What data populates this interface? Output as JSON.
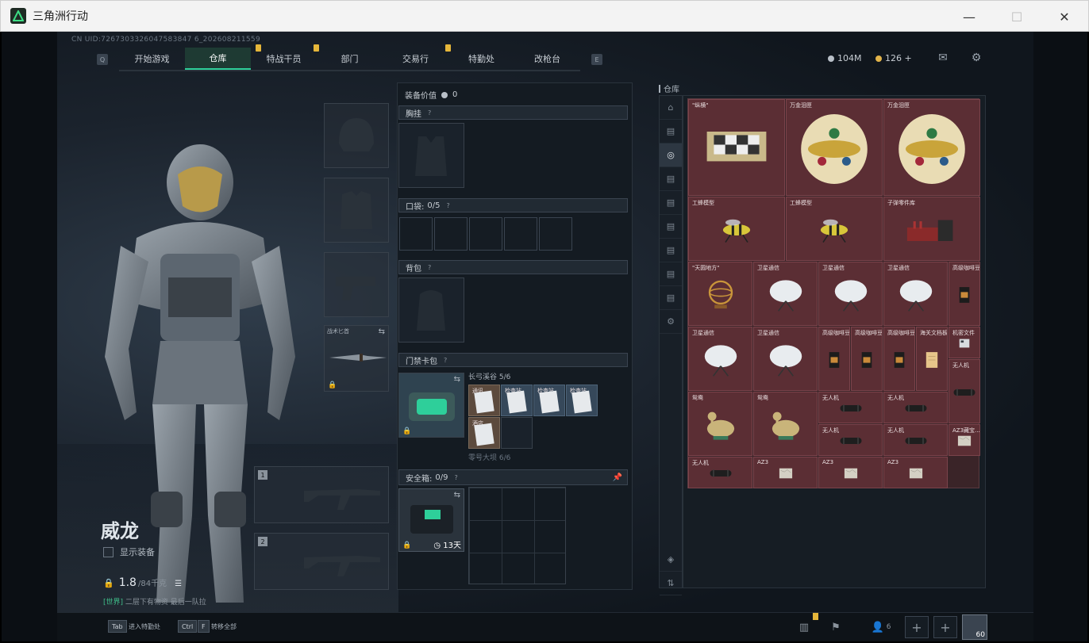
{
  "window": {
    "title": "三角洲行动",
    "minimize": "—",
    "maximize": "☐",
    "close": "✕"
  },
  "uid": "CN UID:7267303326047583847 6_202608211559",
  "nav": {
    "left_key": "Q",
    "right_key": "E",
    "tabs": [
      "开始游戏",
      "仓库",
      "特战干员",
      "部门",
      "交易行",
      "特勤处",
      "改枪台"
    ],
    "active": 1
  },
  "currency": {
    "hafcoin": "104M",
    "coupon": "126 +",
    "hafcoin_color": "#b9c0c8",
    "coupon_color": "#e2b44a"
  },
  "character": {
    "name": "威龙",
    "show_gear_label": "显示装备",
    "weight": "1.8",
    "weight_max": "/84千克",
    "chat_channel": "[世界]",
    "chat_text": " 二层下有物资 最后一队拉"
  },
  "equipment": {
    "knife_label": "战术匕首",
    "weapon_slot_1": "1",
    "weapon_slot_2": "2"
  },
  "gear": {
    "value_label": "装备价值",
    "value": "0",
    "chest_rig": "胸挂",
    "pockets": "口袋:",
    "pockets_value": "0/5",
    "backpack": "背包",
    "keycard": "门禁卡包",
    "card_group_1": "长弓溪谷 5/6",
    "card_group_2": "零号大坝 6/6",
    "mini_items": [
      "通讯",
      "检查站",
      "检查站",
      "检查站",
      "酒店"
    ],
    "safe_label": "安全箱:",
    "safe_value": "0/9",
    "safe_timer": "13天",
    "help": "?"
  },
  "warehouse": {
    "title": "仓库",
    "items": [
      {
        "name": "\"纵横\""
      },
      {
        "name": "万金泪匣"
      },
      {
        "name": "万金泪匣"
      },
      {
        "name": "工蜂模型"
      },
      {
        "name": "工蜂模型"
      },
      {
        "name": "子弹零件库"
      },
      {
        "name": "\"天圆地方\""
      },
      {
        "name": "卫星通信"
      },
      {
        "name": "卫星通信"
      },
      {
        "name": "卫星通信"
      },
      {
        "name": "高级咖啡豆"
      },
      {
        "name": "卫星通信"
      },
      {
        "name": "卫星通信"
      },
      {
        "name": "高级咖啡豆"
      },
      {
        "name": "高级咖啡豆"
      },
      {
        "name": "高级咖啡豆"
      },
      {
        "name": "海关文档板"
      },
      {
        "name": "机密文件"
      },
      {
        "name": "无人机"
      },
      {
        "name": "鸳鸯"
      },
      {
        "name": "鸳鸯"
      },
      {
        "name": "无人机"
      },
      {
        "name": "无人机"
      },
      {
        "name": "无人机"
      },
      {
        "name": "无人机"
      },
      {
        "name": "AZ3藏宝..."
      },
      {
        "name": "无人机"
      },
      {
        "name": "AZ3"
      },
      {
        "name": "AZ3"
      },
      {
        "name": "AZ3"
      }
    ]
  },
  "bottom": {
    "tab_key": "Tab",
    "tab_label": "进入特勤处",
    "ctrl_key": "Ctrl",
    "f_key": "F",
    "transfer_label": "转移全部",
    "friends": "6",
    "level": "60"
  }
}
